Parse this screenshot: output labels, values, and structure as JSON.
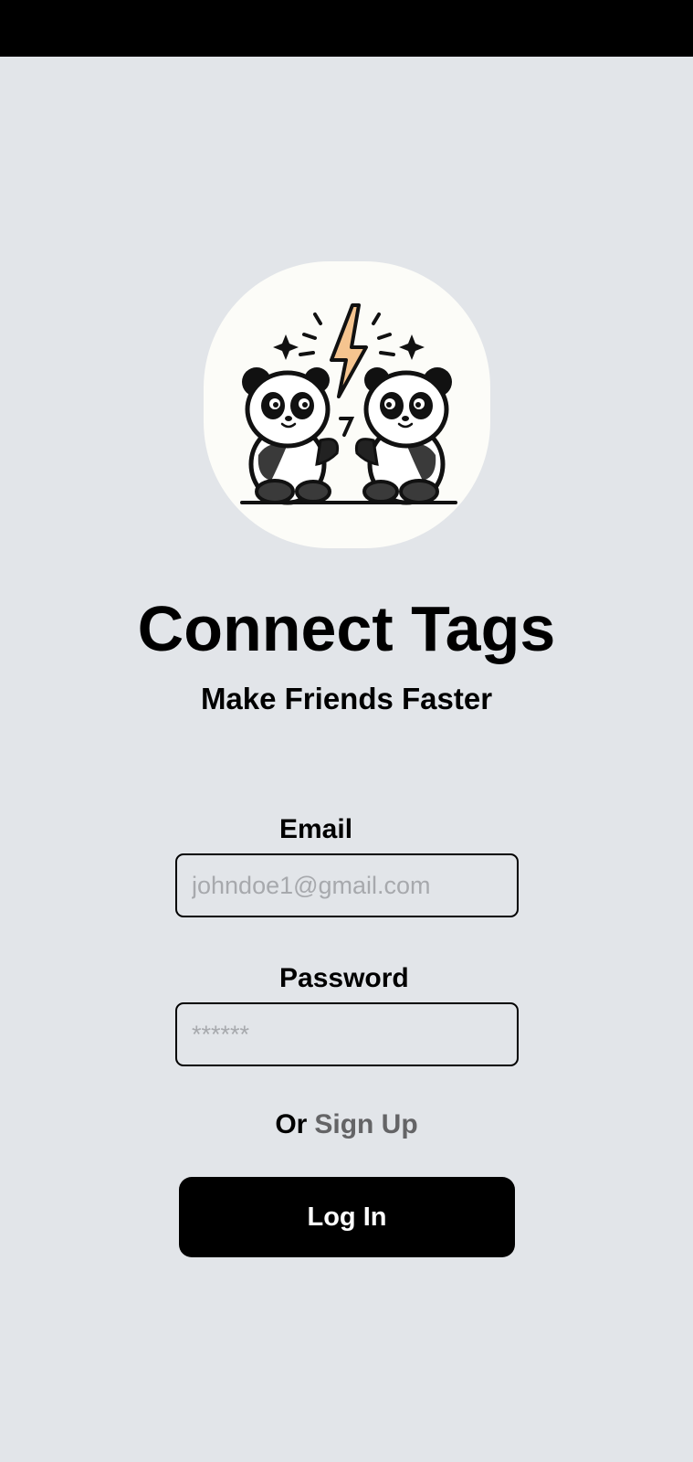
{
  "app": {
    "title": "Connect Tags",
    "subtitle": "Make Friends Faster",
    "logo_icon": "panda-friends-lightning-logo"
  },
  "form": {
    "email_label": "Email",
    "email_placeholder": "johndoe1@gmail.com",
    "email_value": "",
    "password_label": "Password",
    "password_placeholder": "******",
    "password_value": "",
    "or_text": "Or",
    "signup_link": "Sign Up",
    "login_button": "Log In"
  },
  "colors": {
    "background": "#e2e5e9",
    "status_bar": "#000000",
    "logo_background": "#fcfcf8",
    "primary_button": "#000000",
    "link_text": "#646466",
    "placeholder": "#a7a9ad",
    "lightning_fill": "#f5c48f"
  }
}
